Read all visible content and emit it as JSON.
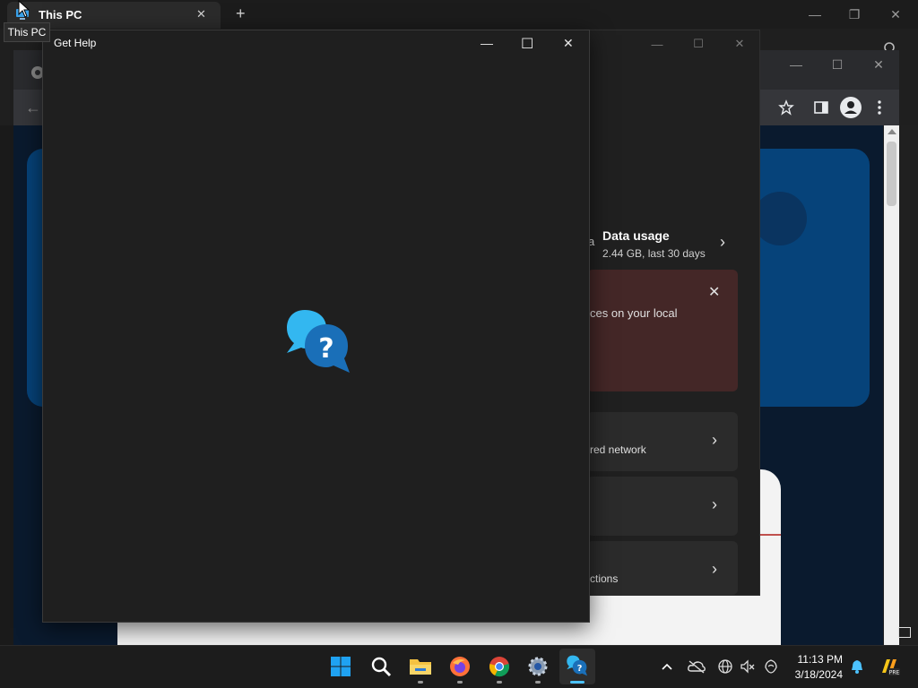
{
  "explorer": {
    "tab_title": "This PC",
    "tooltip": "This PC",
    "new_tab": "+",
    "close_tab": "✕",
    "minimize": "—",
    "restore": "❐",
    "close": "✕"
  },
  "chrome": {
    "minimize": "—",
    "maximize": "☐",
    "close": "✕",
    "back": "←"
  },
  "settings": {
    "data_usage_title": "Data usage",
    "data_usage_sub": "2.44 GB, last 30 days",
    "banner_text": "ces on your local",
    "banner_close": "✕",
    "row1_text": "red network",
    "row3_text": "ctions",
    "chevron": "›",
    "fragment_a": "a",
    "minimize": "—",
    "maximize": "☐",
    "close": "✕"
  },
  "gethelp": {
    "title": "Get Help",
    "minimize": "—",
    "maximize": "☐",
    "close": "✕",
    "icon": "get-help-icon"
  },
  "taskbar": {
    "apps": [
      {
        "name": "start",
        "icon": "windows-logo-icon"
      },
      {
        "name": "search",
        "icon": "search-icon"
      },
      {
        "name": "file-explorer",
        "icon": "folder-icon"
      },
      {
        "name": "firefox",
        "icon": "firefox-icon"
      },
      {
        "name": "chrome",
        "icon": "chrome-icon"
      },
      {
        "name": "settings",
        "icon": "gear-icon"
      },
      {
        "name": "get-help",
        "icon": "get-help-icon"
      }
    ],
    "time": "11:13 PM",
    "date": "3/18/2024"
  },
  "colors": {
    "accent": "#0a84ff",
    "banner": "#442727",
    "hero": "#06437a"
  }
}
